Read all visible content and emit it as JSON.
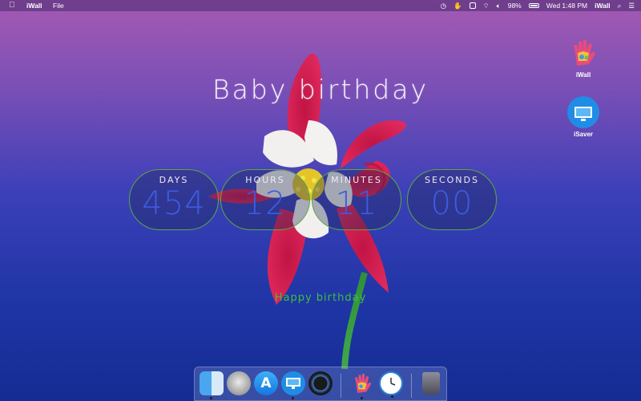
{
  "menubar": {
    "apple_icon": "apple-icon",
    "app_name": "iWall",
    "menus": [
      "File"
    ],
    "status": {
      "battery_percent": "98%",
      "clock": "Wed 1:48 PM",
      "app_label": "iWall"
    }
  },
  "countdown": {
    "title": "Baby birthday",
    "days_label": "DAYS",
    "days_value": "454",
    "hours_label": "HOURS",
    "hours_value": "12",
    "minutes_label": "MINUTES",
    "minutes_value": "11",
    "seconds_label": "SECONDS",
    "seconds_value": "00",
    "message": "Happy birthday"
  },
  "desktop_icons": [
    {
      "label": "iWall",
      "icon": "iwall-hand-icon"
    },
    {
      "label": "iSaver",
      "icon": "isaver-monitor-icon"
    }
  ],
  "dock": [
    "finder-icon",
    "launchpad-icon",
    "app-store-icon",
    "isaver-icon",
    "quicktime-icon",
    "iwall-icon",
    "clock-icon",
    "trash-icon"
  ],
  "colors": {
    "counter_border": "#59a845",
    "counter_value": "#3e5be0",
    "message": "#3fbf3c",
    "accent_blue": "#1f8de6"
  }
}
